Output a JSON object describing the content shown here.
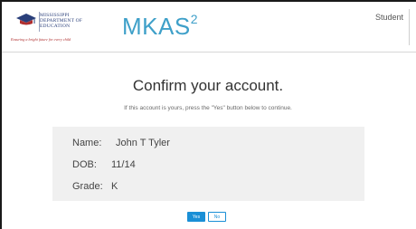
{
  "header": {
    "logo": {
      "lines": [
        "MISSISSIPPI",
        "DEPARTMENT OF",
        "EDUCATION"
      ],
      "tagline": "Ensuring a bright future for every child"
    },
    "app_title": "MKAS",
    "app_title_superscript": "2",
    "user_role": "Student"
  },
  "confirm": {
    "title": "Confirm your account.",
    "subtitle": "If this account is yours, press the \"Yes\" button below to continue."
  },
  "account": {
    "name_label": "Name:",
    "name_value": "John T Tyler",
    "dob_label": "DOB:",
    "dob_value": "11/14",
    "grade_label": "Grade:",
    "grade_value": "K"
  },
  "buttons": {
    "yes_label": "Yes",
    "no_label": "No"
  },
  "colors": {
    "brand_blue": "#3fa0c9",
    "button_blue": "#1a8fd6",
    "panel_bg": "#f0f0f0"
  }
}
